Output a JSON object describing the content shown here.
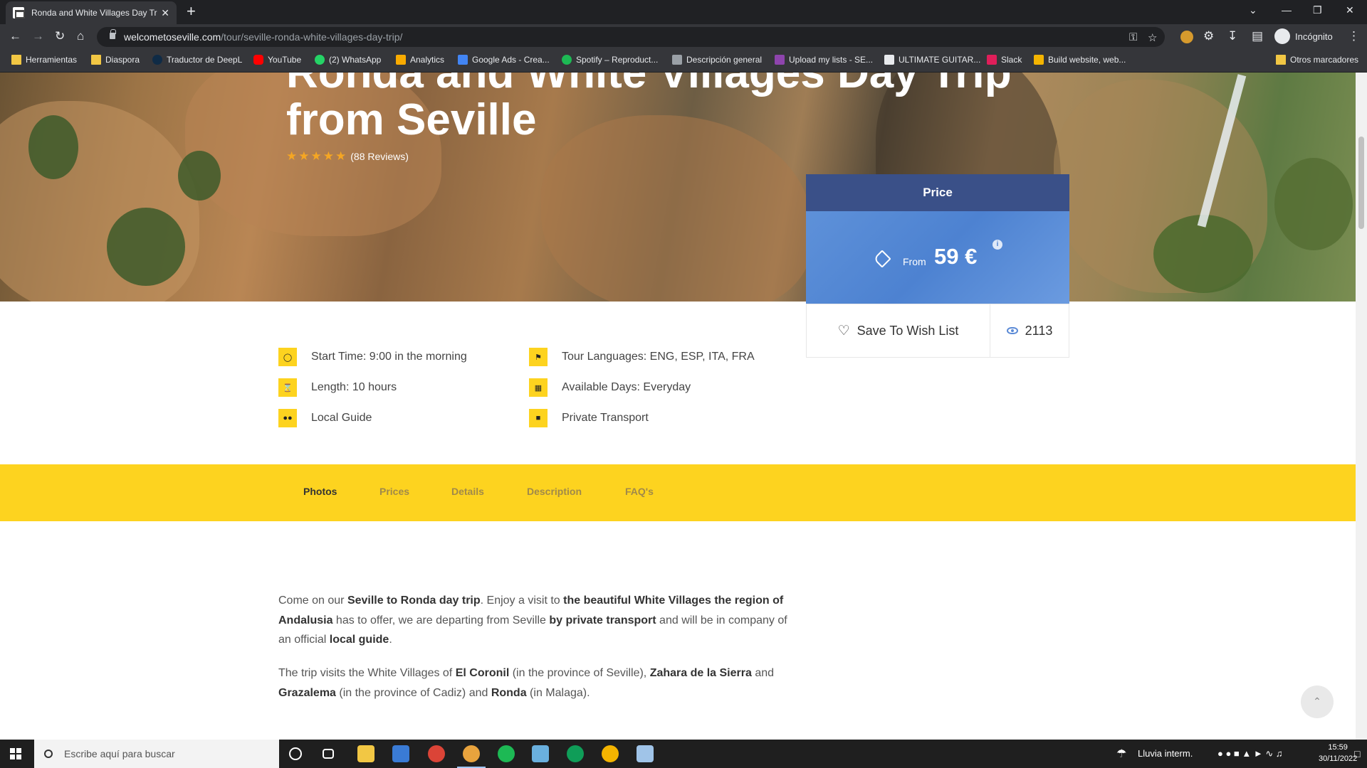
{
  "browser": {
    "tab_title": "Ronda and White Villages Day Tr",
    "tab_close": "✕",
    "new_tab": "+",
    "url_host": "welcometoseville.com",
    "url_path": "/tour/seville-ronda-white-villages-day-trip/",
    "profile_label": "Incógnito",
    "window_controls": [
      "⌄",
      "—",
      "❐",
      "✕"
    ]
  },
  "bookmarks": [
    {
      "label": "Herramientas",
      "icon": "folder-icon",
      "color": "#f2c744"
    },
    {
      "label": "Diaspora",
      "icon": "folder-icon",
      "color": "#f2c744"
    },
    {
      "label": "Traductor de DeepL",
      "icon": "deepl-icon",
      "color": "#0f2b46"
    },
    {
      "label": "YouTube",
      "icon": "youtube-icon",
      "color": "#ff0000"
    },
    {
      "label": "(2) WhatsApp",
      "icon": "whatsapp-icon",
      "color": "#25d366"
    },
    {
      "label": "Analytics",
      "icon": "analytics-icon",
      "color": "#f9ab00"
    },
    {
      "label": "Google Ads - Crea...",
      "icon": "google-ads-icon",
      "color": "#4285f4"
    },
    {
      "label": "Spotify – Reproduct...",
      "icon": "spotify-icon",
      "color": "#1db954"
    },
    {
      "label": "Descripción general",
      "icon": "overview-icon",
      "color": "#9aa0a6"
    },
    {
      "label": "Upload my lists - SE...",
      "icon": "upload-icon",
      "color": "#8e44ad"
    },
    {
      "label": "ULTIMATE GUITAR...",
      "icon": "ultimate-guitar-icon",
      "color": "#e8eaed"
    },
    {
      "label": "Slack",
      "icon": "slack-icon",
      "color": "#e01e5a"
    },
    {
      "label": "Build website, web...",
      "icon": "builder-icon",
      "color": "#f4b400"
    },
    {
      "label": "Otros marcadores",
      "icon": "folder-icon",
      "color": "#f2c744"
    }
  ],
  "page": {
    "title_line1": "Ronda and White Villages Day Trip",
    "title_line2": "from Seville",
    "rating_stars": 5,
    "reviews": "(88 Reviews)",
    "price": {
      "heading": "Price",
      "from_label": "From",
      "value": "59 €",
      "wishlist_label": "Save To Wish List",
      "views": "2113"
    },
    "features": [
      {
        "label": "Start Time: 9:00 in the morning",
        "icon": "clock-icon"
      },
      {
        "label": "Tour Languages: ENG, ESP, ITA, FRA",
        "icon": "flag-icon"
      },
      {
        "label": "Length: 10 hours",
        "icon": "hourglass-icon"
      },
      {
        "label": "Available Days: Everyday",
        "icon": "calendar-icon"
      },
      {
        "label": "Local Guide",
        "icon": "group-icon"
      },
      {
        "label": "Private Transport",
        "icon": "bus-icon"
      }
    ],
    "tabs": [
      "Photos",
      "Prices",
      "Details",
      "Description",
      "FAQ's"
    ],
    "active_tab": "Photos",
    "paragraph1": [
      {
        "t": "Come on our ",
        "b": false
      },
      {
        "t": "Seville to Ronda day trip",
        "b": true
      },
      {
        "t": ". Enjoy a visit to ",
        "b": false
      },
      {
        "t": "the beautiful White Villages the region of Andalusia",
        "b": true
      },
      {
        "t": " has to offer, we are departing from Seville ",
        "b": false
      },
      {
        "t": "by private transport",
        "b": true
      },
      {
        "t": " and will be in company of an official ",
        "b": false
      },
      {
        "t": "local guide",
        "b": true
      },
      {
        "t": ".",
        "b": false
      }
    ],
    "paragraph2": [
      {
        "t": "The trip visits the White Villages of ",
        "b": false
      },
      {
        "t": "El Coronil",
        "b": true
      },
      {
        "t": " (in the province of Seville), ",
        "b": false
      },
      {
        "t": "Zahara de la Sierra",
        "b": true
      },
      {
        "t": " and ",
        "b": false
      },
      {
        "t": "Grazalema",
        "b": true
      },
      {
        "t": " (in the province of Cadiz) and ",
        "b": false
      },
      {
        "t": "Ronda",
        "b": true
      },
      {
        "t": " (in Malaga).",
        "b": false
      }
    ],
    "accent_color": "#fdd31f",
    "price_header_color": "#3a5088",
    "price_body_color": "#4d82d1"
  },
  "taskbar": {
    "search_placeholder": "Escribe aquí para buscar",
    "weather": "Lluvia interm.",
    "time": "15:59",
    "date": "30/11/2022"
  }
}
